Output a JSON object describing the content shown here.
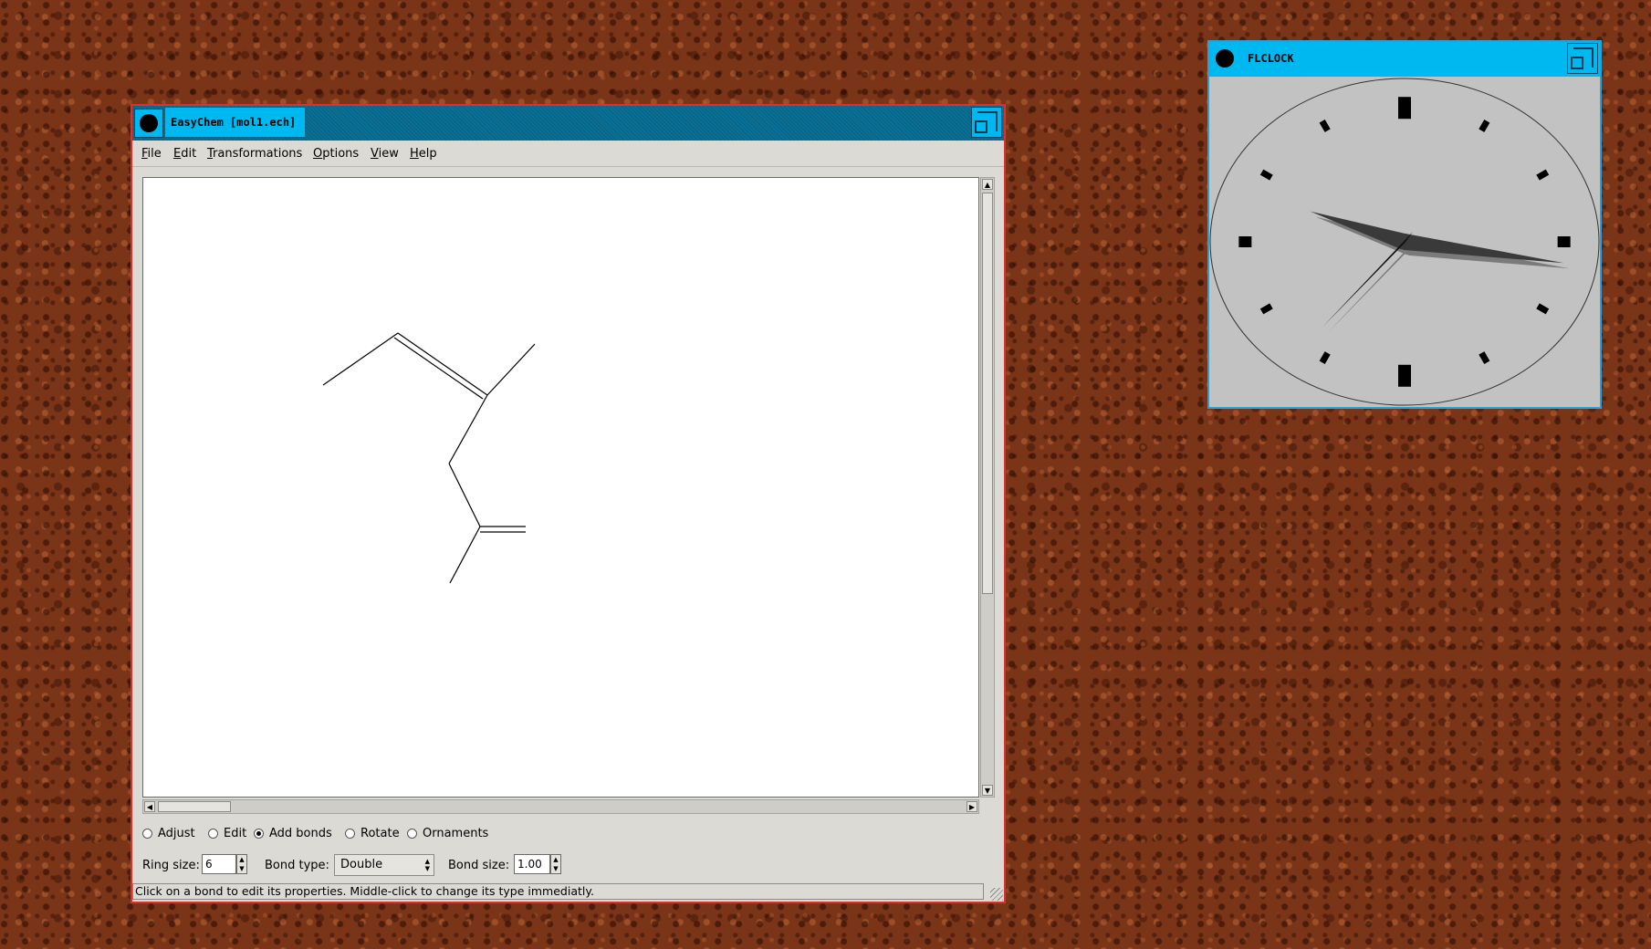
{
  "easychem": {
    "title": "EasyChem [mol1.ech]",
    "menu": [
      {
        "mnemonic": "F",
        "rest": "ile"
      },
      {
        "mnemonic": "E",
        "rest": "dit"
      },
      {
        "mnemonic": "T",
        "rest": "ransformations"
      },
      {
        "mnemonic": "O",
        "rest": "ptions"
      },
      {
        "mnemonic": "V",
        "rest": "iew"
      },
      {
        "mnemonic": "H",
        "rest": "elp"
      }
    ],
    "modes": [
      "Adjust",
      "Edit",
      "Add bonds",
      "Rotate",
      "Ornaments"
    ],
    "selected_mode": "Add bonds",
    "ring_size_label": "Ring size:",
    "ring_size_value": "6",
    "bond_type_label": "Bond type:",
    "bond_type_value": "Double",
    "bond_size_label": "Bond size:",
    "bond_size_value": "1.00",
    "status": "Click on a bond to edit its properties. Middle-click to change its type immediatly."
  },
  "flclock": {
    "title": "FLCLOCK",
    "time": {
      "hour": 9.7,
      "minute": 16.5,
      "second": 36.5
    }
  },
  "colors": {
    "desktop": "#7a3418",
    "title_active": "#00b8f0",
    "title_inactive": "#0a6f94",
    "window_border_easychem": "#e0302c",
    "panel": "#dcdad5",
    "clock_face": "#c2c2c2"
  }
}
